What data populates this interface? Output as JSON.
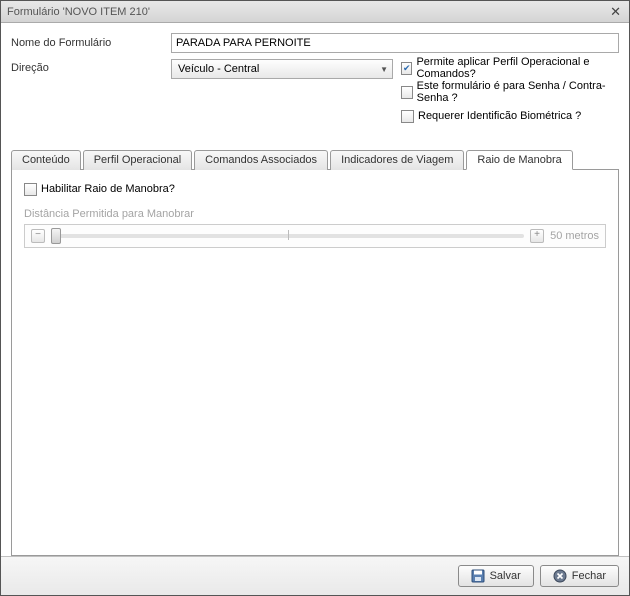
{
  "window": {
    "title": "Formulário 'NOVO ITEM 210'"
  },
  "form": {
    "name_label": "Nome do Formulário",
    "name_value": "PARADA PARA PERNOITE",
    "direction_label": "Direção",
    "direction_value": "Veículo - Central",
    "check_perfil_label": "Permite aplicar Perfil Operacional e Comandos?",
    "check_senha_label": "Este formulário é para Senha / Contra-Senha ?",
    "check_biometrica_label": "Requerer Identificão Biométrica ?"
  },
  "tabs": {
    "conteudo": "Conteúdo",
    "perfil": "Perfil Operacional",
    "comandos": "Comandos Associados",
    "indicadores": "Indicadores de Viagem",
    "raio": "Raio de Manobra"
  },
  "raio_panel": {
    "enable_label": "Habilitar Raio de Manobra?",
    "distance_label": "Distância Permitida para Manobrar",
    "slider_value": "50 metros"
  },
  "footer": {
    "save": "Salvar",
    "close": "Fechar"
  }
}
